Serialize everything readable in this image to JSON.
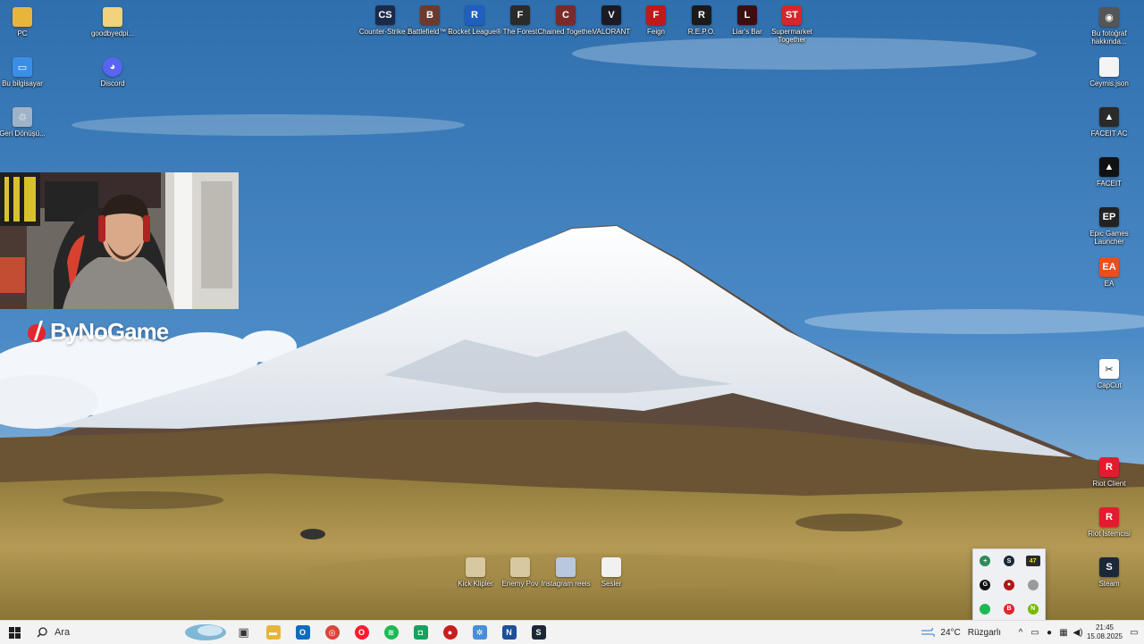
{
  "desktop_icons_left": [
    {
      "label": "PC",
      "icon": "folder-icon",
      "color": "#e8b53c"
    },
    {
      "label": "goodbyedpi...",
      "icon": "folder-icon",
      "color": "#f2d27a"
    },
    {
      "label": "Bu bilgisayar",
      "icon": "computer-icon",
      "color": "#3a8ee6"
    },
    {
      "label": "Discord",
      "icon": "discord-icon",
      "color": "#5865f2"
    },
    {
      "label": "Geri Dönüşü...",
      "icon": "recycle-bin-icon",
      "color": "#9fb3c8"
    }
  ],
  "desktop_icons_top": [
    {
      "label": "Counter-Strike 2",
      "icon": "cs2-icon",
      "color": "#1c2a4a",
      "glyph": "CS"
    },
    {
      "label": "Battlefield™ 1",
      "icon": "battlefield-icon",
      "color": "#6a3b2e",
      "glyph": "B"
    },
    {
      "label": "Rocket League®",
      "icon": "rocket-league-icon",
      "color": "#1f5fbf",
      "glyph": "R"
    },
    {
      "label": "The Forest",
      "icon": "forest-icon",
      "color": "#2b2b2b",
      "glyph": "F"
    },
    {
      "label": "Chained Together",
      "icon": "chained-icon",
      "color": "#7a2a2a",
      "glyph": "C"
    },
    {
      "label": "VALORANT",
      "icon": "valorant-icon",
      "color": "#1b1b25",
      "glyph": "V"
    },
    {
      "label": "Feign",
      "icon": "feign-icon",
      "color": "#c0191c",
      "glyph": "F"
    },
    {
      "label": "R.E.P.O.",
      "icon": "repo-icon",
      "color": "#1a1a1a",
      "glyph": "R"
    },
    {
      "label": "Liar's Bar",
      "icon": "liars-bar-icon",
      "color": "#3b0f12",
      "glyph": "L"
    },
    {
      "label": "Supermarket Together",
      "icon": "supermarket-icon",
      "color": "#d7262b",
      "glyph": "ST"
    }
  ],
  "desktop_icons_right": [
    {
      "label": "Bu fotoğraf hakkında...",
      "icon": "camera-info-icon",
      "color": "#555555",
      "glyph": "◉"
    },
    {
      "label": "Ceymis.json",
      "icon": "file-icon",
      "color": "#f4f4f4",
      "glyph": ""
    },
    {
      "label": "FACEIT AC",
      "icon": "faceit-ac-icon",
      "color": "#2a2a2a",
      "glyph": "▲"
    },
    {
      "label": "FACEIT",
      "icon": "faceit-icon",
      "color": "#111111",
      "glyph": "▲"
    },
    {
      "label": "Epic Games Launcher",
      "icon": "epic-icon",
      "color": "#222222",
      "glyph": "EP"
    },
    {
      "label": "EA",
      "icon": "ea-icon",
      "color": "#e94f1d",
      "glyph": "EA"
    },
    {
      "label": "CapCut",
      "icon": "capcut-icon",
      "color": "#ffffff",
      "glyph": "✂"
    },
    {
      "label": "Riot Client",
      "icon": "riot-icon",
      "color": "#e31b2f",
      "glyph": "R"
    },
    {
      "label": "Riot İstemcisi",
      "icon": "riot-client-tr-icon",
      "color": "#e31b2f",
      "glyph": "R"
    },
    {
      "label": "Steam",
      "icon": "steam-icon",
      "color": "#1b2838",
      "glyph": "S"
    }
  ],
  "desktop_icons_bottom": [
    {
      "label": "Kick Klipler",
      "icon": "folder-icon",
      "color": "#d8c8a0"
    },
    {
      "label": "Enemy Pov",
      "icon": "folder-icon",
      "color": "#d8c8a0"
    },
    {
      "label": "Instagram reels",
      "icon": "folder-icon",
      "color": "#b9c8dc"
    },
    {
      "label": "Sesler",
      "icon": "folder-icon",
      "color": "#f1f1f1"
    }
  ],
  "branding": {
    "text": "ByNoGame",
    "accent": "#e4252c"
  },
  "tray_flyout": [
    {
      "icon": "shield-icon",
      "color": "#2e8b57",
      "glyph": "+"
    },
    {
      "icon": "steam-tray-icon",
      "color": "#1b2838",
      "glyph": "S"
    },
    {
      "icon": "counter-badge-icon",
      "color": "#2a2a2a",
      "glyph": "47"
    },
    {
      "icon": "gauge-icon",
      "color": "#111111",
      "glyph": "G"
    },
    {
      "icon": "game-tray-icon",
      "color": "#b01818",
      "glyph": "●"
    },
    {
      "icon": "circle-gray-icon",
      "color": "#9a9a9a",
      "glyph": ""
    },
    {
      "icon": "spotify-tray-icon",
      "color": "#1db954",
      "glyph": ""
    },
    {
      "icon": "bynogame-tray-icon",
      "color": "#e4252c",
      "glyph": "B"
    },
    {
      "icon": "nvidia-tray-icon",
      "color": "#76b900",
      "glyph": "N"
    }
  ],
  "taskbar": {
    "search_placeholder": "Ara",
    "apps": [
      {
        "icon": "task-view-icon",
        "color": "#3c3c3c",
        "glyph": "▣"
      },
      {
        "icon": "file-explorer-icon",
        "color": "#e8b53c",
        "glyph": "▬"
      },
      {
        "icon": "outlook-icon",
        "color": "#0f6cbd",
        "glyph": "O"
      },
      {
        "icon": "chrome-icon",
        "color": "#db4437",
        "glyph": "◎"
      },
      {
        "icon": "opera-icon",
        "color": "#ff1b2d",
        "glyph": "O"
      },
      {
        "icon": "spotify-icon",
        "color": "#1db954",
        "glyph": "≋"
      },
      {
        "icon": "whatsapp-like-icon",
        "color": "#18a05e",
        "glyph": "◘"
      },
      {
        "icon": "game-launcher-icon",
        "color": "#c81e1e",
        "glyph": "●"
      },
      {
        "icon": "settings-app-icon",
        "color": "#4a8fd6",
        "glyph": "✲"
      },
      {
        "icon": "notepad-plus-icon",
        "color": "#1d4f9c",
        "glyph": "N"
      },
      {
        "icon": "steam-taskbar-icon",
        "color": "#1b2838",
        "glyph": "S"
      }
    ],
    "weather": {
      "temp": "24°C",
      "condition": "Rüzgarlı"
    },
    "clock": {
      "time": "21:45",
      "date": "15.08.2025"
    }
  }
}
